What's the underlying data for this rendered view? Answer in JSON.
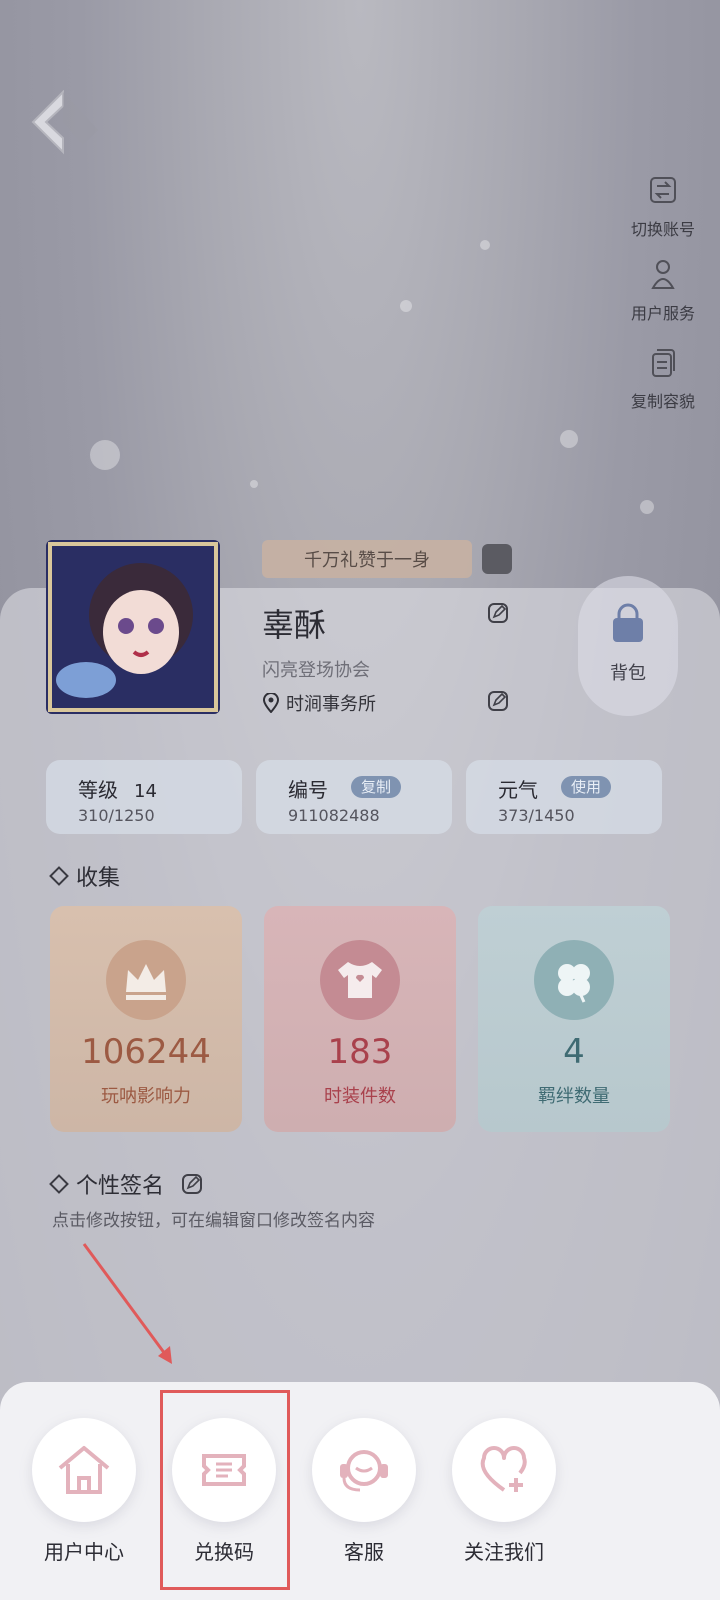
{
  "side_menu": [
    {
      "label": "切换账号",
      "icon": "switch-account-icon"
    },
    {
      "label": "用户服务",
      "icon": "user-service-icon"
    },
    {
      "label": "复制容貌",
      "icon": "copy-appearance-icon"
    }
  ],
  "profile": {
    "badge_text": "千万礼赞于一身",
    "name": "辜酥",
    "club": "闪亮登场协会",
    "location": "时涧事务所"
  },
  "bag_label": "背包",
  "stats": [
    {
      "label": "等级",
      "value": "14",
      "sub": "310/1250"
    },
    {
      "label": "编号",
      "tag": "复制",
      "sub": "911082488"
    },
    {
      "label": "元气",
      "tag": "使用",
      "sub": "373/1450"
    }
  ],
  "collection": {
    "title": "收集",
    "cards": [
      {
        "value": "106244",
        "caption": "玩呐影响力",
        "icon": "crown-icon",
        "color": "#c77b54"
      },
      {
        "value": "183",
        "caption": "时装件数",
        "icon": "tshirt-icon",
        "color": "#b64f56"
      },
      {
        "value": "4",
        "caption": "羁绊数量",
        "icon": "clover-icon",
        "color": "#4f7b84"
      }
    ]
  },
  "signature": {
    "title": "个性签名",
    "hint": "点击修改按钮，可在编辑窗口修改签名内容"
  },
  "bottom_actions": [
    {
      "label": "用户中心",
      "icon": "home-icon"
    },
    {
      "label": "兑换码",
      "icon": "ticket-icon"
    },
    {
      "label": "客服",
      "icon": "headset-icon"
    },
    {
      "label": "关注我们",
      "icon": "heart-plus-icon"
    }
  ],
  "colors": {
    "highlight": "#e05a5a",
    "icon_pink": "#e3b2bc"
  }
}
